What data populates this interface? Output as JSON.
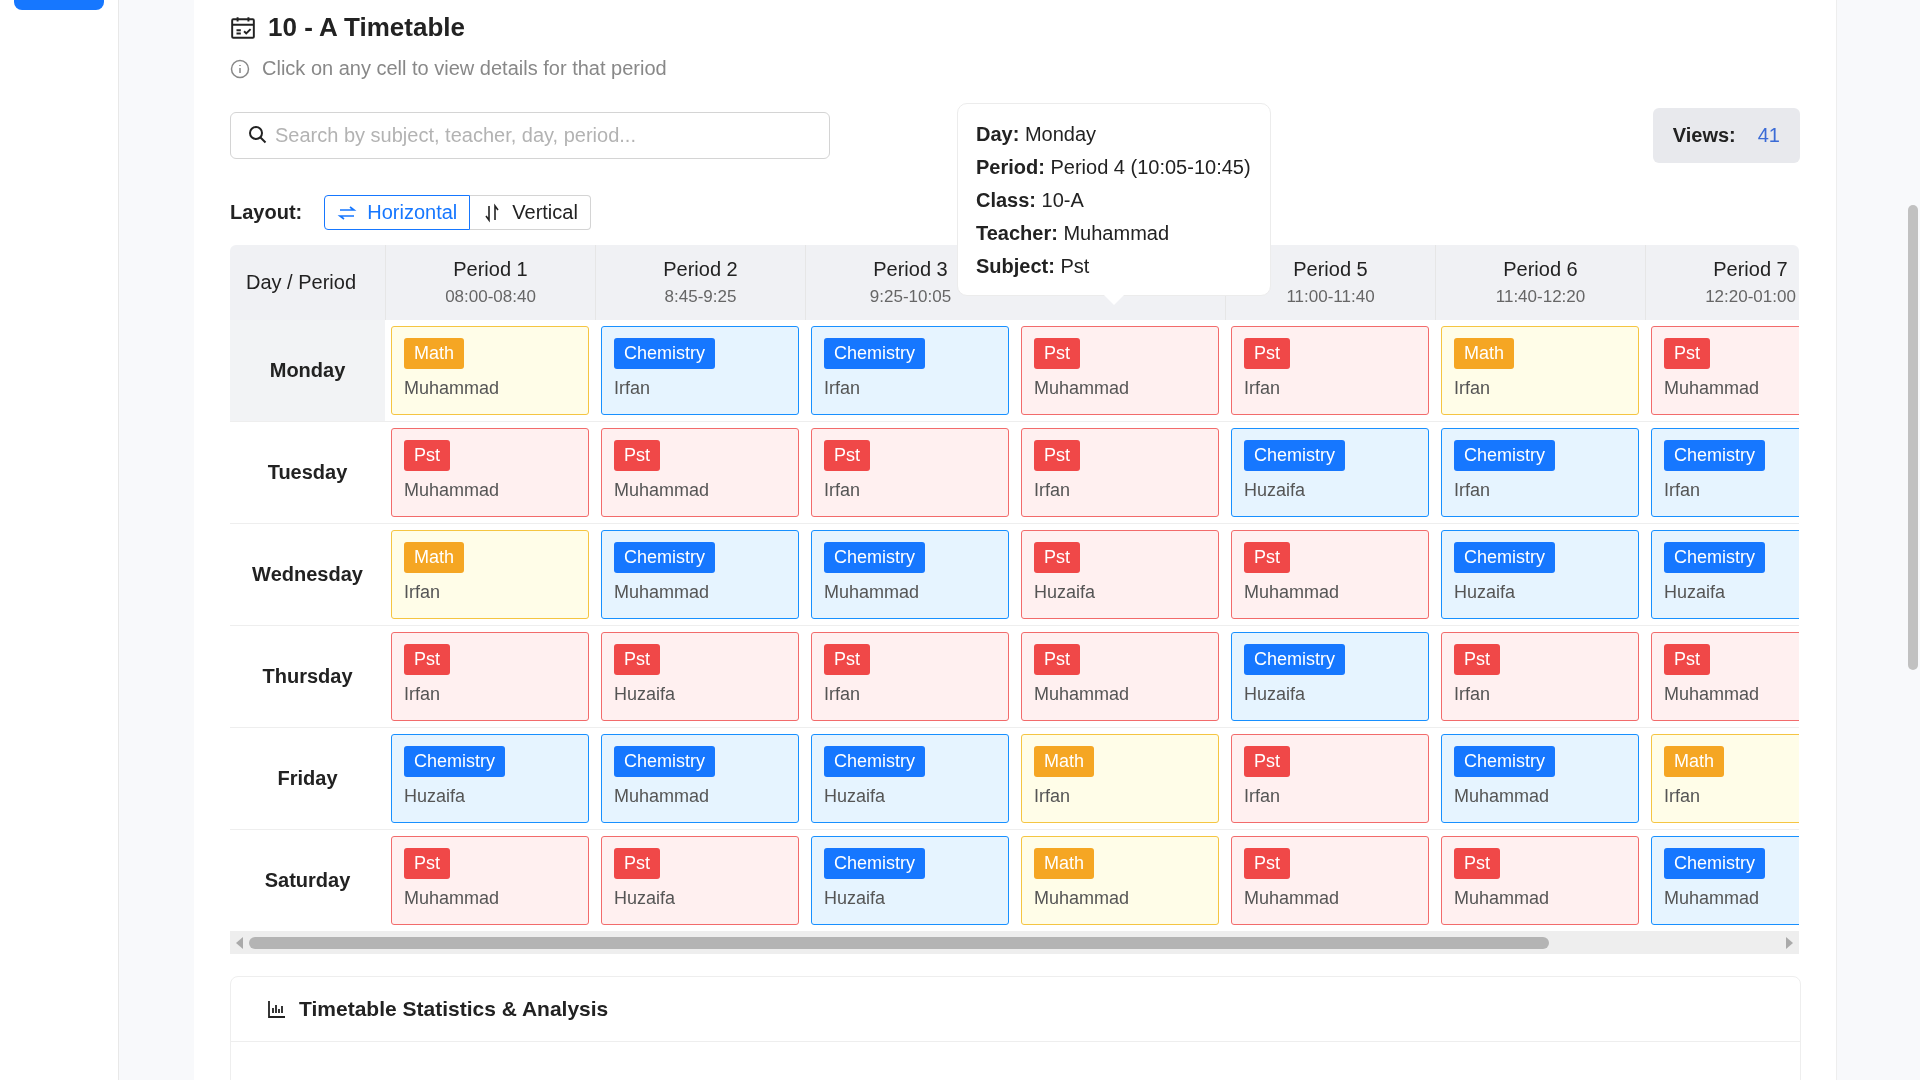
{
  "title": "10 - A Timetable",
  "hint": "Click on any cell to view details for that period",
  "search": {
    "placeholder": "Search by subject, teacher, day, period..."
  },
  "views": {
    "label": "Views:",
    "value": "41"
  },
  "layout": {
    "label": "Layout:",
    "options": [
      {
        "label": "Horizontal",
        "kind": "horizontal",
        "selected": true
      },
      {
        "label": "Vertical",
        "kind": "vertical",
        "selected": false
      }
    ]
  },
  "tooltip": {
    "lines": [
      "**Day:** Monday",
      "**Period:** Period 4 (10:05-10:45)",
      "**Class:** 10-A",
      "**Teacher:** Muhammad",
      "**Subject:** Pst"
    ]
  },
  "table": {
    "corner": "Day / Period",
    "periods": [
      {
        "label": "Period 1",
        "time": "08:00-08:40"
      },
      {
        "label": "Period 2",
        "time": "8:45-9:25"
      },
      {
        "label": "Period 3",
        "time": "9:25-10:05"
      },
      {
        "label": "Period 5",
        "time": "11:00-11:40"
      },
      {
        "label": "Period 6",
        "time": "11:40-12:20"
      },
      {
        "label": "Period 7",
        "time": "12:20-01:00"
      }
    ],
    "rows": [
      {
        "day": "Monday",
        "hovered": true,
        "cells": [
          {
            "kind": "math",
            "subject": "Math",
            "teacher": "Muhammad"
          },
          {
            "kind": "chemistry",
            "subject": "Chemistry",
            "teacher": "Irfan"
          },
          {
            "kind": "chemistry",
            "subject": "Chemistry",
            "teacher": "Irfan"
          },
          {
            "kind": "pst",
            "subject": "Pst",
            "teacher": "Muhammad"
          },
          {
            "kind": "pst",
            "subject": "Pst",
            "teacher": "Irfan"
          },
          {
            "kind": "math",
            "subject": "Math",
            "teacher": "Irfan"
          },
          {
            "kind": "pst",
            "subject": "Pst",
            "teacher": "Muhammad"
          }
        ]
      },
      {
        "day": "Tuesday",
        "hovered": false,
        "cells": [
          {
            "kind": "pst",
            "subject": "Pst",
            "teacher": "Muhammad"
          },
          {
            "kind": "pst",
            "subject": "Pst",
            "teacher": "Muhammad"
          },
          {
            "kind": "pst",
            "subject": "Pst",
            "teacher": "Irfan"
          },
          {
            "kind": "pst",
            "subject": "Pst",
            "teacher": "Irfan"
          },
          {
            "kind": "chemistry",
            "subject": "Chemistry",
            "teacher": "Huzaifa"
          },
          {
            "kind": "chemistry",
            "subject": "Chemistry",
            "teacher": "Irfan"
          },
          {
            "kind": "chemistry",
            "subject": "Chemistry",
            "teacher": "Irfan"
          }
        ]
      },
      {
        "day": "Wednesday",
        "hovered": false,
        "cells": [
          {
            "kind": "math",
            "subject": "Math",
            "teacher": "Irfan"
          },
          {
            "kind": "chemistry",
            "subject": "Chemistry",
            "teacher": "Muhammad"
          },
          {
            "kind": "chemistry",
            "subject": "Chemistry",
            "teacher": "Muhammad"
          },
          {
            "kind": "pst",
            "subject": "Pst",
            "teacher": "Huzaifa"
          },
          {
            "kind": "pst",
            "subject": "Pst",
            "teacher": "Muhammad"
          },
          {
            "kind": "chemistry",
            "subject": "Chemistry",
            "teacher": "Huzaifa"
          },
          {
            "kind": "chemistry",
            "subject": "Chemistry",
            "teacher": "Huzaifa"
          }
        ]
      },
      {
        "day": "Thursday",
        "hovered": false,
        "cells": [
          {
            "kind": "pst",
            "subject": "Pst",
            "teacher": "Irfan"
          },
          {
            "kind": "pst",
            "subject": "Pst",
            "teacher": "Huzaifa"
          },
          {
            "kind": "pst",
            "subject": "Pst",
            "teacher": "Irfan"
          },
          {
            "kind": "pst",
            "subject": "Pst",
            "teacher": "Muhammad"
          },
          {
            "kind": "chemistry",
            "subject": "Chemistry",
            "teacher": "Huzaifa"
          },
          {
            "kind": "pst",
            "subject": "Pst",
            "teacher": "Irfan"
          },
          {
            "kind": "pst",
            "subject": "Pst",
            "teacher": "Muhammad"
          }
        ]
      },
      {
        "day": "Friday",
        "hovered": false,
        "cells": [
          {
            "kind": "chemistry",
            "subject": "Chemistry",
            "teacher": "Huzaifa"
          },
          {
            "kind": "chemistry",
            "subject": "Chemistry",
            "teacher": "Muhammad"
          },
          {
            "kind": "chemistry",
            "subject": "Chemistry",
            "teacher": "Huzaifa"
          },
          {
            "kind": "math",
            "subject": "Math",
            "teacher": "Irfan"
          },
          {
            "kind": "pst",
            "subject": "Pst",
            "teacher": "Irfan"
          },
          {
            "kind": "chemistry",
            "subject": "Chemistry",
            "teacher": "Muhammad"
          },
          {
            "kind": "math",
            "subject": "Math",
            "teacher": "Irfan"
          }
        ]
      },
      {
        "day": "Saturday",
        "hovered": false,
        "cells": [
          {
            "kind": "pst",
            "subject": "Pst",
            "teacher": "Muhammad"
          },
          {
            "kind": "pst",
            "subject": "Pst",
            "teacher": "Huzaifa"
          },
          {
            "kind": "chemistry",
            "subject": "Chemistry",
            "teacher": "Huzaifa"
          },
          {
            "kind": "math",
            "subject": "Math",
            "teacher": "Muhammad"
          },
          {
            "kind": "pst",
            "subject": "Pst",
            "teacher": "Muhammad"
          },
          {
            "kind": "pst",
            "subject": "Pst",
            "teacher": "Muhammad"
          },
          {
            "kind": "chemistry",
            "subject": "Chemistry",
            "teacher": "Muhammad"
          }
        ]
      }
    ]
  },
  "stats": {
    "title": "Timetable Statistics & Analysis"
  }
}
